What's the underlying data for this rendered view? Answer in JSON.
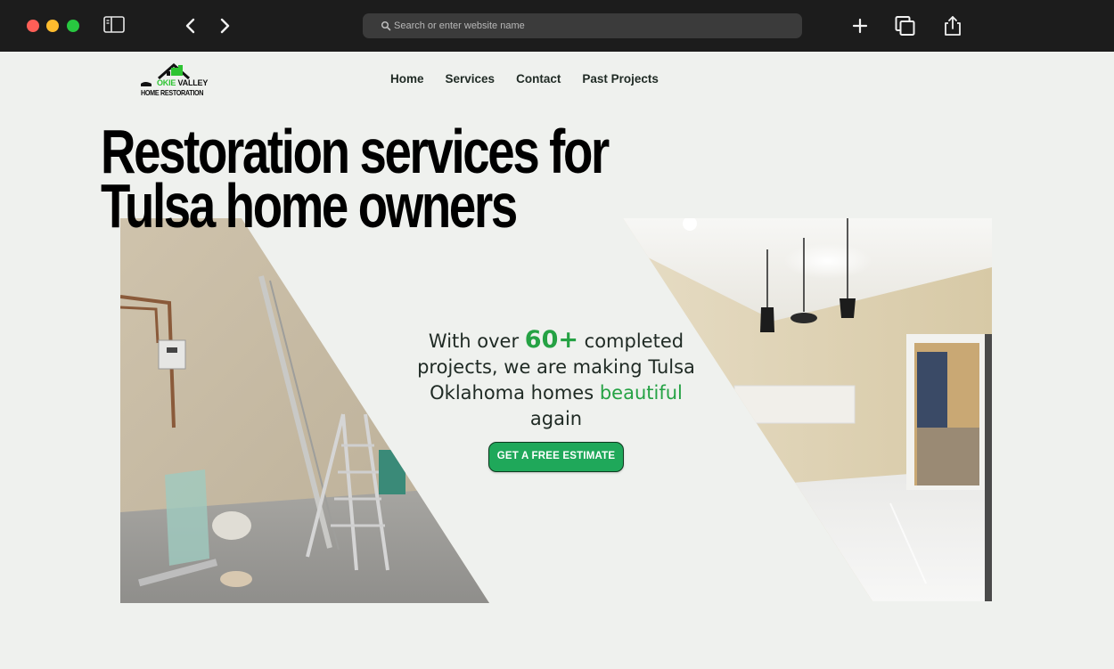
{
  "browser": {
    "search_placeholder": "Search or enter website name"
  },
  "logo": {
    "line1_part1": "OKIE",
    "line1_part2": "VALLEY",
    "line2": "HOME RESTORATION"
  },
  "nav": {
    "items": [
      "Home",
      "Services",
      "Contact",
      "Past Projects"
    ]
  },
  "hero": {
    "title_line1": "Restoration services for",
    "title_line2": "Tulsa home owners",
    "tagline_pre": "With over ",
    "tagline_num": "60+",
    "tagline_mid": " completed projects, we are making Tulsa Oklahoma homes ",
    "tagline_accent": "beautiful",
    "tagline_post": " again",
    "cta_label": "GET A FREE ESTIMATE"
  },
  "colors": {
    "accent": "#25a244",
    "button": "#1fa85a",
    "page_bg": "#eff1ee",
    "chrome_bg": "#1c1c1c"
  }
}
